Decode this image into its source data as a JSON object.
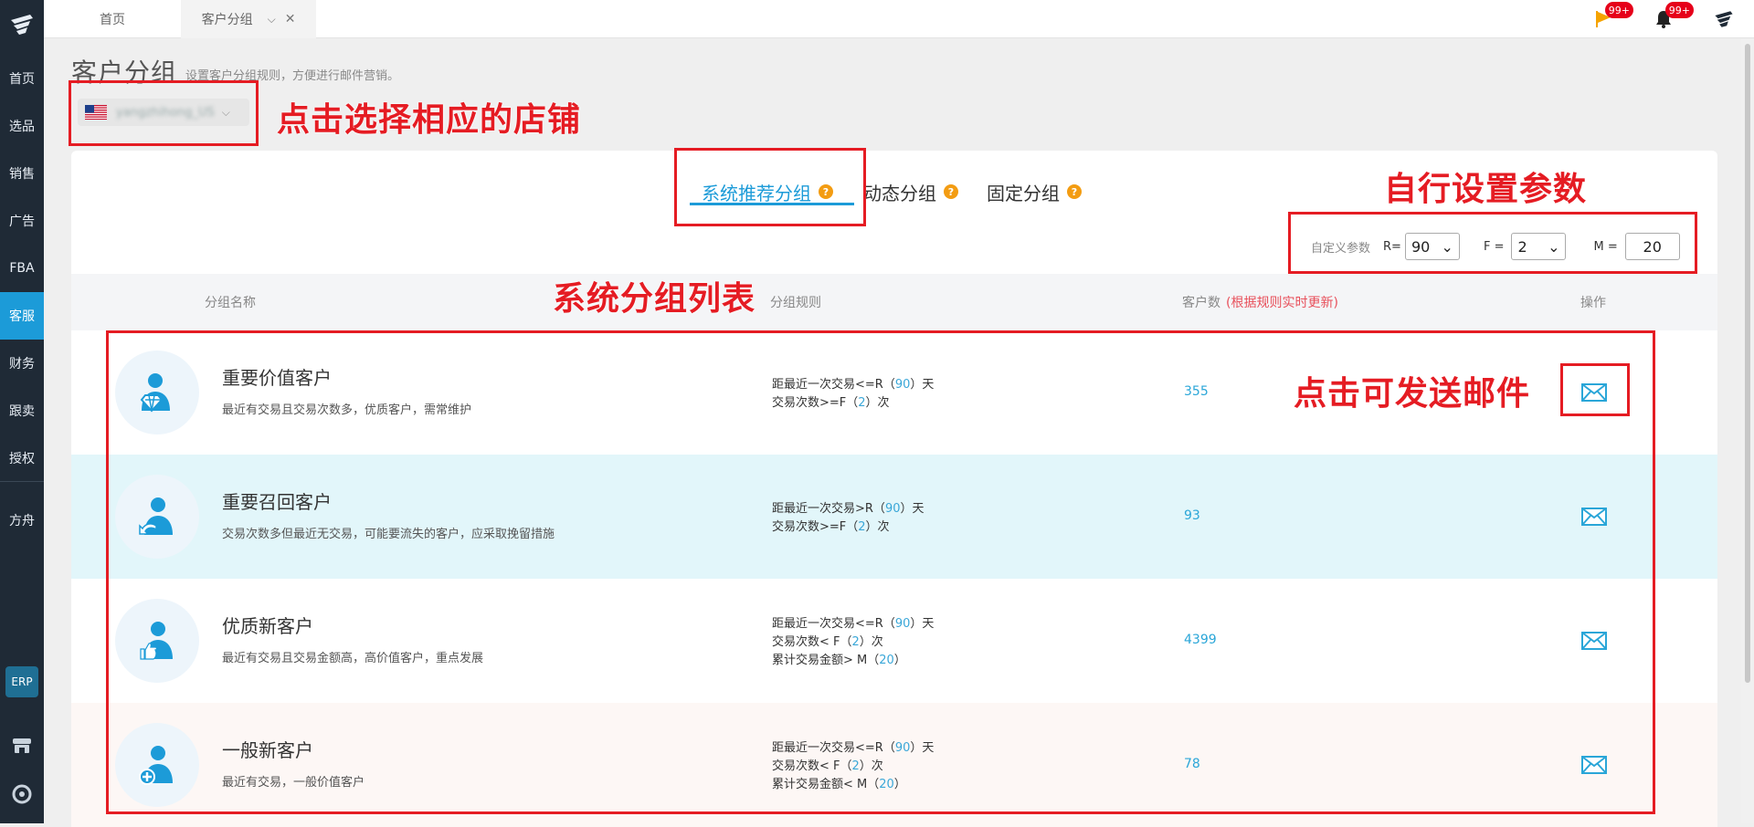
{
  "sidebar": {
    "items": [
      {
        "label": "首页"
      },
      {
        "label": "选品"
      },
      {
        "label": "销售"
      },
      {
        "label": "广告"
      },
      {
        "label": "FBA"
      },
      {
        "label": "客服",
        "active": true
      },
      {
        "label": "财务"
      },
      {
        "label": "跟卖"
      },
      {
        "label": "授权"
      },
      {
        "label": "方舟"
      }
    ],
    "erp_label": "ERP"
  },
  "topbar": {
    "tabs": [
      {
        "label": "首页"
      },
      {
        "label": "客户分组",
        "active": true
      }
    ],
    "notifications": {
      "flag_badge": "99+",
      "bell_badge": "99+"
    }
  },
  "page": {
    "title": "客户分组",
    "subtitle": "设置客户分组规则，方便进行邮件营销。",
    "store_select": {
      "value": "yangzhihong_US",
      "flag": "US"
    }
  },
  "annotations": {
    "store": "点击选择相应的店铺",
    "params": "自行设置参数",
    "list": "系统分组列表",
    "mail": "点击可发送邮件"
  },
  "segment_tabs": [
    {
      "label": "系统推荐分组",
      "active": true
    },
    {
      "label": "动态分组"
    },
    {
      "label": "固定分组"
    }
  ],
  "params": {
    "label": "自定义参数",
    "r_label": "R=",
    "r_value": "90",
    "f_label": "F =",
    "f_value": "2",
    "m_label": "M =",
    "m_value": "20"
  },
  "table": {
    "headers": {
      "name": "分组名称",
      "rule": "分组规则",
      "count": "客户数",
      "count_note": "(根据规则实时更新)",
      "action": "操作"
    },
    "rows": [
      {
        "name": "重要价值客户",
        "desc": "最近有交易且交易次数多，优质客户，需常维护",
        "rules": [
          {
            "pre": "距最近一次交易<=R（",
            "val": "90",
            "post": "）天"
          },
          {
            "pre": "交易次数>=F（",
            "val": "2",
            "post": "）次"
          }
        ],
        "count": "355",
        "icon": "diamond-user-icon"
      },
      {
        "name": "重要召回客户",
        "desc": "交易次数多但最近无交易，可能要流失的客户，应采取挽留措施",
        "rules": [
          {
            "pre": "距最近一次交易>R（",
            "val": "90",
            "post": "）天"
          },
          {
            "pre": "交易次数>=F（",
            "val": "2",
            "post": "）次"
          }
        ],
        "count": "93",
        "icon": "recall-user-icon"
      },
      {
        "name": "优质新客户",
        "desc": "最近有交易且交易金额高，高价值客户，重点发展",
        "rules": [
          {
            "pre": "距最近一次交易<=R（",
            "val": "90",
            "post": "）天"
          },
          {
            "pre": "交易次数< F（",
            "val": "2",
            "post": "）次"
          },
          {
            "pre": "累计交易金额> M（",
            "val": "20",
            "post": "）"
          }
        ],
        "count": "4399",
        "icon": "thumbs-up-user-icon"
      },
      {
        "name": "一般新客户",
        "desc": "最近有交易，一般价值客户",
        "rules": [
          {
            "pre": "距最近一次交易<=R（",
            "val": "90",
            "post": "）天"
          },
          {
            "pre": "交易次数< F（",
            "val": "2",
            "post": "）次"
          },
          {
            "pre": "累计交易金额< M（",
            "val": "20",
            "post": "）"
          }
        ],
        "count": "78",
        "icon": "plus-user-icon"
      }
    ]
  },
  "colors": {
    "accent": "#1c9bd8",
    "annotation": "#e51c23",
    "sidebar_bg": "#1f2a36"
  }
}
